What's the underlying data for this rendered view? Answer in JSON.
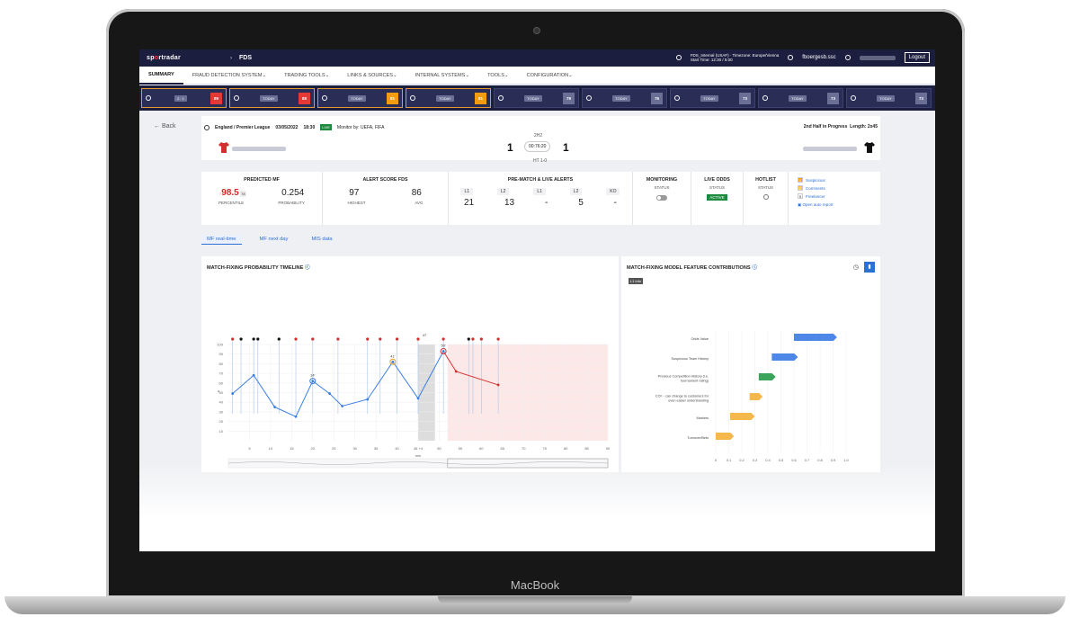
{
  "device": {
    "brand": "MacBook"
  },
  "topbar": {
    "logo_part1": "sp",
    "logo_o": "o",
    "logo_part2": "rtradar",
    "breadcrumb_sep": "›",
    "app_name": "FDS",
    "env_line1": "FDS_Internal (USAF) · Timezone: Europe/Vienna",
    "env_line2": "Start Time: 12:30 / 5:00",
    "username": "fboergesb.ssc",
    "logout": "Logout"
  },
  "nav": [
    "SUMMARY",
    "FRAUD DETECTION SYSTEM",
    "TRADING TOOLS",
    "LINKS & SOURCES",
    "INTERNAL SYSTEMS",
    "TOOLS",
    "CONFIGURATION"
  ],
  "strip": [
    {
      "mid_top": "LIVE",
      "mid": "2 : 1",
      "value": "89",
      "color": "#e53935",
      "flag": true
    },
    {
      "mid": "TODAY",
      "value": "88",
      "color": "#e53935",
      "flag": true
    },
    {
      "mid": "TODAY",
      "value": "81",
      "color": "#f39c12",
      "flag": true
    },
    {
      "mid": "TODAY",
      "value": "81",
      "color": "#f39c12",
      "flag": true
    },
    {
      "mid": "TODAY",
      "value": "79",
      "color": "#6a6f95",
      "flag": false
    },
    {
      "mid": "TODAY",
      "value": "76",
      "color": "#6a6f95",
      "flag": false
    },
    {
      "mid": "TODAY",
      "value": "73",
      "color": "#6a6f95",
      "flag": false
    },
    {
      "mid": "TODAY",
      "value": "73",
      "color": "#6a6f95",
      "flag": false
    },
    {
      "mid": "TODAY",
      "value": "73",
      "color": "#6a6f95",
      "flag": false
    }
  ],
  "match": {
    "back": "Back",
    "competition": "England / Premier League",
    "date": "03/05/2022",
    "time": "18:30",
    "live": "LIVE",
    "monitor": "Monitor by: UEFA, FIFA",
    "phase": "2nd Half in Progress",
    "length": "Length: 2x45",
    "period": "2H2",
    "home_score": "1",
    "away_score": "1",
    "clock": "00:76:20",
    "half_time": "HT 1-0"
  },
  "kpi": {
    "predicted": {
      "title": "PREDICTED MF",
      "arrow": "↑",
      "percentile_value": "98.5",
      "badge": "78",
      "probability_value": "0.254",
      "percentile_label": "PERCENTILE",
      "probability_label": "PROBABILITY"
    },
    "alert": {
      "title": "ALERT SCORE FDS",
      "highest_value": "97",
      "avg_value": "86",
      "highest_label": "HIGHEST",
      "avg_label": "AVG"
    },
    "pre": {
      "title": "PRE-MATCH & LIVE ALERTS",
      "labels": [
        "L1",
        "L2",
        "L1",
        "L2",
        "KO"
      ],
      "values": [
        "21",
        "13",
        "-",
        "5",
        "-"
      ]
    },
    "monitoring": {
      "title": "MONITORING",
      "sub": "STATUS"
    },
    "liveodds": {
      "title": "LIVE ODDS",
      "sub": "STATUS",
      "badge": "ACTIVE"
    },
    "hotlist": {
      "title": "HOTLIST",
      "sub": "STATUS"
    },
    "links": [
      {
        "code": "S",
        "label": "Suspicious",
        "color": "#f39c12"
      },
      {
        "code": "C",
        "label": "Comments",
        "color": "#f4c542"
      },
      {
        "code": "S",
        "label": "Freelancer",
        "color": "#ffffff"
      }
    ],
    "open_report": "Open auto report"
  },
  "tabs": [
    "MF real-time",
    "MF next day",
    "MIS data"
  ],
  "timeline": {
    "title": "MATCH-FIXING PROBABILITY TIMELINE"
  },
  "features": {
    "title": "MATCH-FIXING MODEL FEATURE CONTRIBUTIONS",
    "legend_tag": "L1 info"
  },
  "chart_data": [
    {
      "type": "line",
      "title": "MATCH-FIXING PROBABILITY TIMELINE",
      "xlabel": "min",
      "ylabel": "#",
      "ylim": [
        0,
        100
      ],
      "x_ticks": [
        "5",
        "10",
        "15",
        "20",
        "25",
        "30",
        "35",
        "40",
        "45 +4",
        "50",
        "55",
        "60",
        "65",
        "70",
        "75",
        "80",
        "85",
        "90"
      ],
      "y_ticks": [
        "10",
        "20",
        "30",
        "40",
        "50",
        "60",
        "70",
        "80",
        "90",
        "100"
      ],
      "series": [
        {
          "values": [
            [
              1,
              49
            ],
            [
              6,
              68
            ],
            [
              11,
              35
            ],
            [
              16,
              25
            ],
            [
              20,
              62
            ],
            [
              24,
              49
            ],
            [
              27,
              36
            ],
            [
              33,
              43
            ],
            [
              39,
              82
            ],
            [
              45,
              44
            ],
            [
              51,
              93
            ],
            [
              54,
              72
            ],
            [
              64,
              58
            ]
          ]
        }
      ],
      "annotations": [
        "14'",
        "41'",
        "50'",
        "47"
      ]
    },
    {
      "type": "bar",
      "title": "MATCH-FIXING MODEL FEATURE CONTRIBUTIONS",
      "categories": [
        "Odds Value",
        "Suspicious Team History",
        "Previous Competition History (i.e. tournament rating)",
        "CCF - can change to customers for even easier understanding",
        "Markets",
        "Turnover/Bets"
      ],
      "ranges": [
        [
          0.6,
          0.93
        ],
        [
          0.43,
          0.63
        ],
        [
          0.33,
          0.46
        ],
        [
          0.26,
          0.36
        ],
        [
          0.11,
          0.3
        ],
        [
          0.0,
          0.14
        ]
      ],
      "colors": [
        "#4d87e8",
        "#4d87e8",
        "#3aa55a",
        "#f4b84c",
        "#f4b84c",
        "#f4b84c"
      ],
      "x_ticks": [
        "0",
        "0.1",
        "0.2",
        "0.3",
        "0.4",
        "0.5",
        "0.6",
        "0.7",
        "0.8",
        "0.9",
        "1.0"
      ]
    }
  ]
}
